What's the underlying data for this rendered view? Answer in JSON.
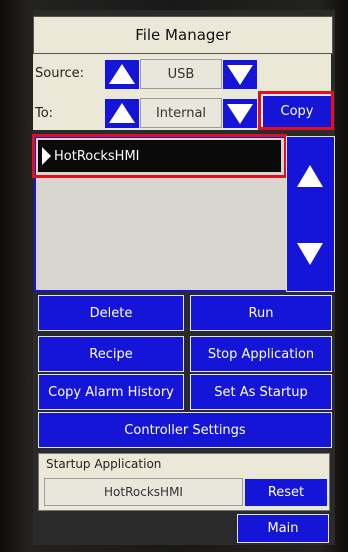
{
  "window": {
    "title": "File Manager"
  },
  "source": {
    "label": "Source:",
    "value": "USB"
  },
  "to": {
    "label": "To:",
    "value": "Internal"
  },
  "copy_button": "Copy",
  "file_list": {
    "items": [
      "HotRocksHMI"
    ],
    "selected_index": 0
  },
  "buttons": {
    "delete": "Delete",
    "run": "Run",
    "recipe": "Recipe",
    "stop_application": "Stop Application",
    "copy_alarm_history": "Copy Alarm History",
    "set_as_startup": "Set As Startup",
    "controller_settings": "Controller Settings",
    "reset": "Reset",
    "main": "Main"
  },
  "startup": {
    "label": "Startup Application",
    "value": "HotRocksHMI"
  },
  "colors": {
    "button_blue": "#1515d8",
    "highlight_red": "#e0101c",
    "panel_beige": "#ece8d8"
  }
}
